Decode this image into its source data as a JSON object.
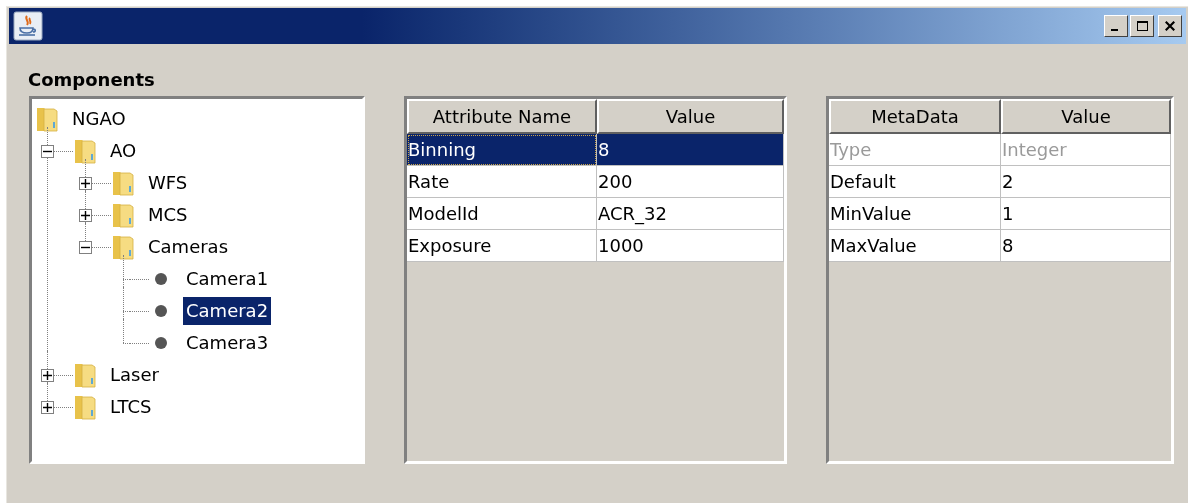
{
  "window": {
    "buttons": [
      {
        "kind": "minimize"
      },
      {
        "kind": "maximize"
      },
      {
        "kind": "close"
      }
    ]
  },
  "components_label": "Components",
  "tree": [
    {
      "label": "NGAO",
      "kind": "folder",
      "expanded": true,
      "selected": false,
      "children": [
        {
          "label": "AO",
          "kind": "folder",
          "expanded": true,
          "selected": false,
          "children": [
            {
              "label": "WFS",
              "kind": "folder",
              "expanded": false,
              "selected": false
            },
            {
              "label": "MCS",
              "kind": "folder",
              "expanded": false,
              "selected": false
            },
            {
              "label": "Cameras",
              "kind": "folder",
              "expanded": true,
              "selected": false,
              "children": [
                {
                  "label": "Camera1",
                  "kind": "leaf",
                  "selected": false
                },
                {
                  "label": "Camera2",
                  "kind": "leaf",
                  "selected": true
                },
                {
                  "label": "Camera3",
                  "kind": "leaf",
                  "selected": false
                }
              ]
            }
          ]
        },
        {
          "label": "Laser",
          "kind": "folder",
          "expanded": false,
          "selected": false
        },
        {
          "label": "LTCS",
          "kind": "folder",
          "expanded": false,
          "selected": false
        }
      ]
    }
  ],
  "attributes_table": {
    "columns": [
      "Attribute Name",
      "Value"
    ],
    "rows": [
      {
        "cells": [
          "Binning",
          "8"
        ],
        "selected": true
      },
      {
        "cells": [
          "Rate",
          "200"
        ],
        "selected": false
      },
      {
        "cells": [
          "ModelId",
          "ACR_32"
        ],
        "selected": false
      },
      {
        "cells": [
          "Exposure",
          "1000"
        ],
        "selected": false
      }
    ]
  },
  "metadata_table": {
    "columns": [
      "MetaData",
      "Value"
    ],
    "rows": [
      {
        "cells": [
          "Type",
          "Integer"
        ],
        "disabled": true
      },
      {
        "cells": [
          "Default",
          "2"
        ],
        "disabled": false
      },
      {
        "cells": [
          "MinValue",
          "1"
        ],
        "disabled": false
      },
      {
        "cells": [
          "MaxValue",
          "8"
        ],
        "disabled": false
      }
    ]
  }
}
